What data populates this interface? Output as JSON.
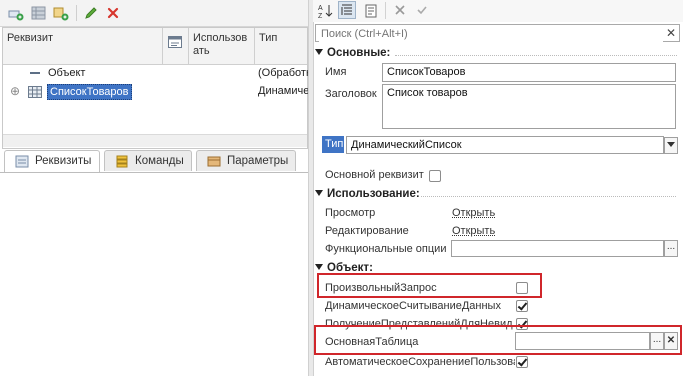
{
  "left": {
    "toolbar": [
      "add-attribute-icon",
      "add-table-icon",
      "add-column-icon",
      "edit-icon",
      "delete-icon"
    ],
    "grid": {
      "headers": {
        "requisite": "Реквизит",
        "usage": "Использов\nать",
        "type": "Тип"
      },
      "rows": [
        {
          "name": "Объект",
          "type": "(Обработк"
        },
        {
          "name": "СписокТоваров",
          "type": "Динамиче"
        }
      ]
    },
    "tabs": [
      {
        "label": "Реквизиты"
      },
      {
        "label": "Команды"
      },
      {
        "label": "Параметры"
      }
    ]
  },
  "right": {
    "search_placeholder": "Поиск (Ctrl+Alt+I)",
    "sections": {
      "main": "Основные:",
      "usage": "Использование:",
      "object": "Объект:"
    },
    "props": {
      "name_label": "Имя",
      "name_value": "СписокТоваров",
      "title_label": "Заголовок",
      "title_value": "Список товаров",
      "type_label": "Тип",
      "type_value": "ДинамическийСписок",
      "main_attr_label": "Основной реквизит",
      "view_label": "Просмотр",
      "view_link": "Открыть",
      "edit_label": "Редактирование",
      "edit_link": "Открыть",
      "func_label": "Функциональные опции",
      "custom_query_label": "ПроизвольныйЗапрос",
      "dyn_read_label": "ДинамическоеСчитываниеДанных",
      "get_repr_label": "ПолучениеПредставленийДляНевид",
      "main_table_label": "ОсновнаяТаблица",
      "main_table_value": "",
      "autosave_label": "АвтоматическоеСохранениеПользова"
    },
    "checks": {
      "main_attr": false,
      "custom_query": false,
      "dyn_read": true,
      "get_repr": true,
      "autosave": true
    },
    "highlight_color": "#d0262b"
  }
}
